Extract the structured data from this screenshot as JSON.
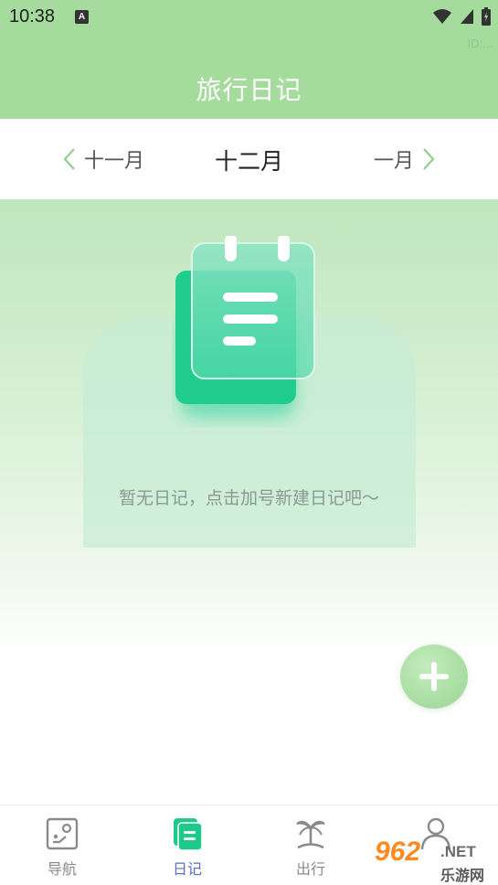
{
  "status_bar": {
    "time": "10:38",
    "notification_badge": "A",
    "icons": [
      "wifi-icon",
      "signal-icon",
      "battery-icon"
    ],
    "id_text": "ID:..."
  },
  "header": {
    "title": "旅行日记"
  },
  "month_nav": {
    "prev_label": "十一月",
    "current_label": "十二月",
    "next_label": "一月"
  },
  "empty_state": {
    "message": "暂无日记，点击加号新建日记吧～",
    "icon": "diary-notebook-icon"
  },
  "fab": {
    "icon": "plus-icon"
  },
  "bottom_nav": {
    "items": [
      {
        "label": "导航",
        "icon": "map-icon",
        "active": false
      },
      {
        "label": "日记",
        "icon": "diary-icon",
        "active": true
      },
      {
        "label": "出行",
        "icon": "palm-tree-icon",
        "active": false
      },
      {
        "label": "",
        "icon": "person-icon",
        "active": false
      }
    ]
  },
  "watermark": {
    "brand": "962",
    "domain": ".NET",
    "cn": "乐游网"
  },
  "colors": {
    "header_green": "#a5dc9d",
    "accent_teal": "#2fd39b",
    "active_nav": "#5b6dc8",
    "chevron": "#8fd08a"
  }
}
